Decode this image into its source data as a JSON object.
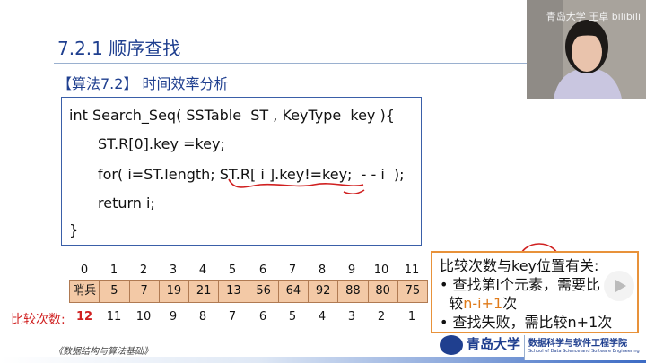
{
  "slide": {
    "title": "7.2.1 顺序查找",
    "algorithm_heading": "【算法7.2】 时间效率分析",
    "code_lines": [
      "int Search_Seq( SSTable  ST , KeyType  key ){",
      "ST.R[0].key =key;",
      "for( i=ST.length; ST.R[ i ].key!=key;  - - i  );",
      "return i;",
      "}"
    ],
    "indices": [
      "0",
      "1",
      "2",
      "3",
      "4",
      "5",
      "6",
      "7",
      "8",
      "9",
      "10",
      "11"
    ],
    "array_cells": [
      "哨兵",
      "5",
      "7",
      "19",
      "21",
      "13",
      "56",
      "64",
      "92",
      "88",
      "80",
      "75"
    ],
    "compare_label": "比较次数:",
    "compare_counts": [
      "12",
      "11",
      "10",
      "9",
      "8",
      "7",
      "6",
      "5",
      "4",
      "3",
      "2",
      "1"
    ],
    "note": {
      "line1": "比较次数与key位置有关:",
      "line2": "• 查找第i个元素，需要比",
      "line3_prefix": "较",
      "line3_highlight": "n-i+1",
      "line3_suffix": "次",
      "line4": "• 查找失败，需比较n+1次"
    },
    "footer_text": "《数据结构与算法基础》",
    "university_name": "青岛大学",
    "school_name_cn": "数据科学与软件工程学院",
    "school_name_en": "School of Data Science and Software Engineering"
  },
  "video": {
    "watermark": "青岛大学 王卓 bilibili"
  },
  "colors": {
    "title_blue": "#1f3f8f",
    "ink_red": "#d02020",
    "highlight_orange": "#e07b1a",
    "array_fill": "#f3c9a6"
  }
}
